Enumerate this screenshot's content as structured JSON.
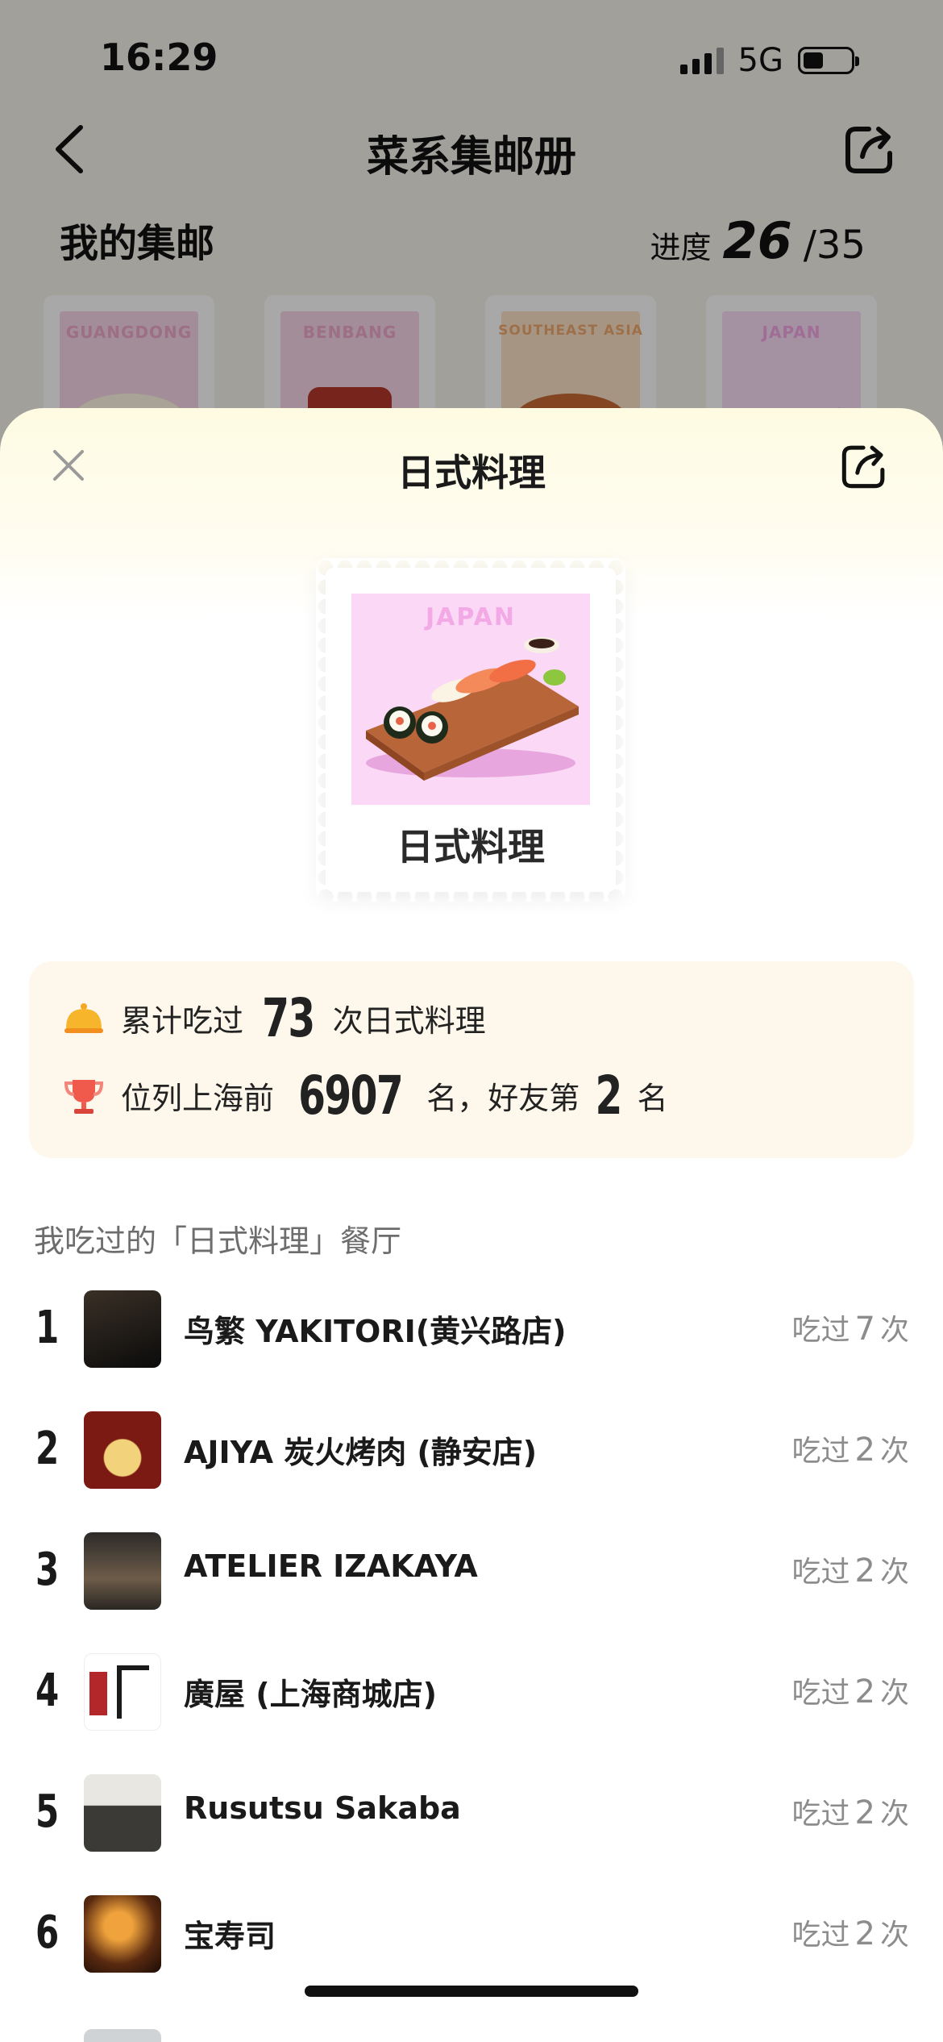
{
  "status_bar": {
    "time": "16:29",
    "network": "5G"
  },
  "nav": {
    "title": "菜系集邮册"
  },
  "album": {
    "section_title": "我的集邮",
    "progress_label": "进度",
    "progress_value": "26",
    "progress_total": "/35",
    "stamps": [
      {
        "label": "GUANGDONG",
        "color": "#f6d7e7"
      },
      {
        "label": "BENBANG",
        "color": "#f6d7e7"
      },
      {
        "label": "SOUTHEAST ASIA",
        "color": "#fde3c8"
      },
      {
        "label": "JAPAN",
        "color": "#f9dcf4"
      }
    ]
  },
  "sheet": {
    "title": "日式料理",
    "stamp": {
      "caption": "JAPAN",
      "name": "日式料理"
    },
    "stats": {
      "eaten_prefix": "累计吃过",
      "eaten_count": "73",
      "eaten_suffix": "次日式料理",
      "rank_prefix": "位列上海前",
      "rank_city": "6907",
      "rank_mid": "名，好友第",
      "rank_friends": "2",
      "rank_suffix": "名"
    },
    "list_title": "我吃过的「日式料理」餐厅",
    "visit_prefix": "吃过",
    "visit_suffix": "次",
    "restaurants": [
      {
        "rank": "1",
        "name": "鸟繁 YAKITORI(黄兴路店)",
        "count": "7"
      },
      {
        "rank": "2",
        "name": "AJIYA 炭火烤肉 (静安店)",
        "count": "2"
      },
      {
        "rank": "3",
        "name": "ATELIER IZAKAYA",
        "count": "2"
      },
      {
        "rank": "4",
        "name": "廣屋 (上海商城店)",
        "count": "2"
      },
      {
        "rank": "5",
        "name": "Rusutsu Sakaba",
        "count": "2"
      },
      {
        "rank": "6",
        "name": "宝寿司",
        "count": "2"
      }
    ]
  }
}
